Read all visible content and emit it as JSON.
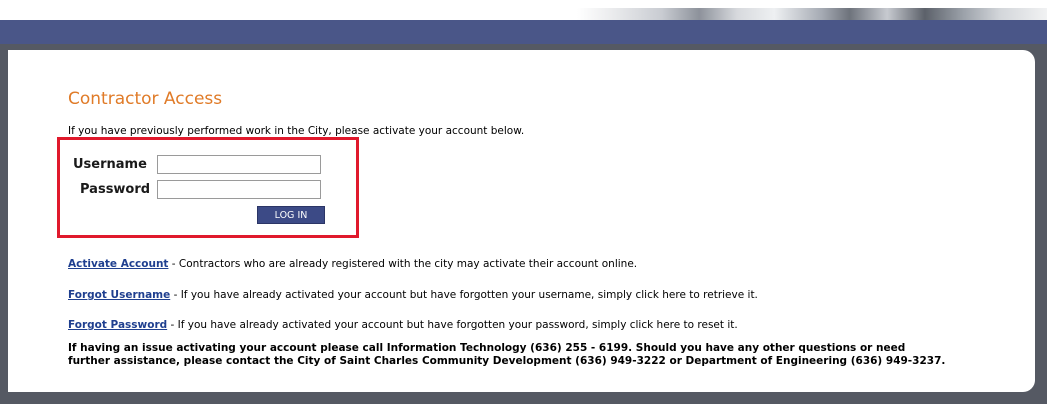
{
  "page": {
    "title": "Contractor Access",
    "intro": "If you have previously performed work in the City, please activate your account below."
  },
  "login_form": {
    "username_label": "Username",
    "password_label": "Password",
    "username_value": "",
    "password_value": "",
    "login_button": "LOG IN"
  },
  "links": [
    {
      "label": "Activate Account",
      "description": " - Contractors who are already registered with the city may activate their account online."
    },
    {
      "label": "Forgot Username",
      "description": " - If you have already activated your account but have forgotten your username, simply click here to retrieve it."
    },
    {
      "label": "Forgot Password",
      "description": " - If you have already activated your account but have forgotten your password, simply click here to reset it."
    }
  ],
  "notice": {
    "line1": "If having an issue activating your account please call Information Technology (636) 255 - 6199. Should you have any other questions or need",
    "line2": "further assistance, please contact the City of Saint Charles Community Development (636) 949-3222 or Department of Engineering (636) 949-3237."
  },
  "colors": {
    "nav_bar": "#4a5688",
    "background": "#555963",
    "title": "#e07b28",
    "highlight": "#e0192c",
    "button": "#3c4a86",
    "link": "#1f3f8f"
  }
}
